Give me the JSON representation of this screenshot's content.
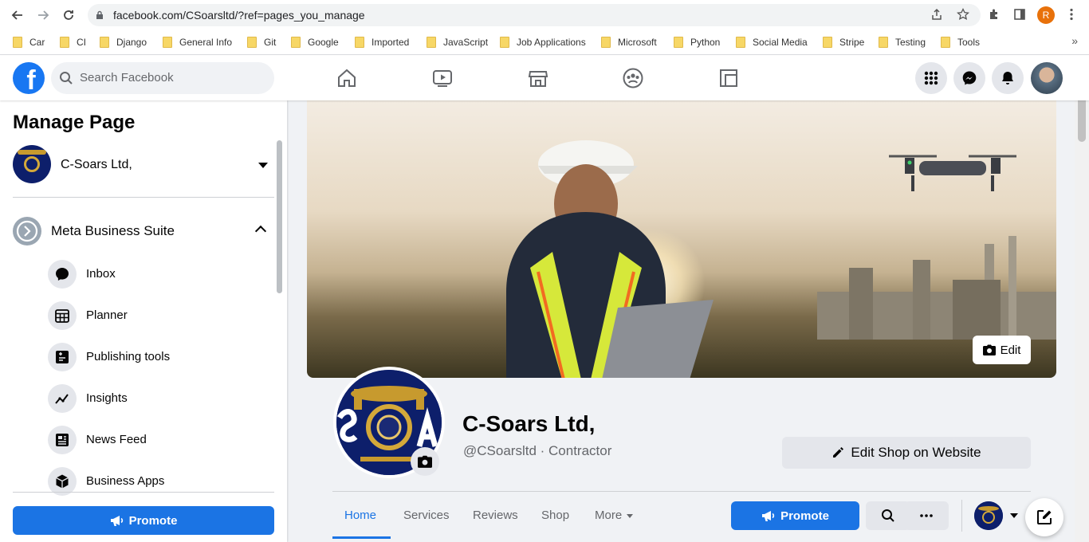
{
  "browser": {
    "url": "facebook.com/CSoarsltd/?ref=pages_you_manage",
    "profile_initial": "R",
    "bookmarks": [
      "Car",
      "CI",
      "Django",
      "General Info",
      "Git",
      "Google",
      "Imported",
      "JavaScript",
      "Job Applications",
      "Microsoft",
      "Python",
      "Social Media",
      "Stripe",
      "Testing",
      "Tools"
    ],
    "bookmarks_more": "»"
  },
  "header": {
    "logo_letter": "f",
    "search_placeholder": "Search Facebook"
  },
  "sidebar": {
    "title": "Manage Page",
    "page_name": "C-Soars Ltd,",
    "business_suite_label": "Meta Business Suite",
    "items": [
      {
        "label": "Inbox",
        "icon": "chat-bubble-icon"
      },
      {
        "label": "Planner",
        "icon": "calendar-grid-icon"
      },
      {
        "label": "Publishing tools",
        "icon": "publishing-tools-icon"
      },
      {
        "label": "Insights",
        "icon": "insights-chart-icon"
      },
      {
        "label": "News Feed",
        "icon": "news-feed-icon"
      },
      {
        "label": "Business Apps",
        "icon": "cube-icon"
      }
    ],
    "promote_label": "Promote"
  },
  "page": {
    "name": "C-Soars Ltd,",
    "handle_category": "@CSoarsltd · Contractor",
    "edit_cover_label": "Edit",
    "edit_shop_label": "Edit Shop on Website",
    "tabs": [
      {
        "label": "Home",
        "active": true
      },
      {
        "label": "Services",
        "active": false
      },
      {
        "label": "Reviews",
        "active": false
      },
      {
        "label": "Shop",
        "active": false
      },
      {
        "label": "More",
        "active": false
      }
    ],
    "promote_label": "Promote"
  },
  "colors": {
    "accent": "#1b74e4",
    "logo_navy": "#0d1f6b",
    "logo_gold": "#d4a93a"
  }
}
